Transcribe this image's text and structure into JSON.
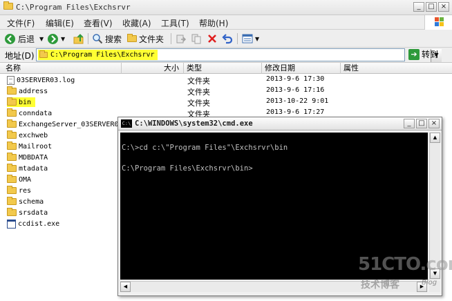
{
  "explorer": {
    "title": "C:\\Program Files\\Exchsrvr",
    "menu": [
      "文件(F)",
      "编辑(E)",
      "查看(V)",
      "收藏(A)",
      "工具(T)",
      "帮助(H)"
    ],
    "toolbar": {
      "back_label": "后退",
      "search_label": "搜索",
      "folders_label": "文件夹"
    },
    "address": {
      "label": "地址(D)",
      "value": "C:\\Program Files\\Exchsrvr",
      "go_label": "转到"
    },
    "columns": {
      "name": "名称",
      "size": "大小",
      "type": "类型",
      "modified": "修改日期",
      "attributes": "属性"
    },
    "files": [
      {
        "name": "03SERVER03.log",
        "icon": "document-icon",
        "type": "文件夹",
        "date": "2013-9-6 17:30"
      },
      {
        "name": "address",
        "icon": "folder-icon",
        "type": "文件夹",
        "date": "2013-9-6 17:16"
      },
      {
        "name": "bin",
        "icon": "folder-icon",
        "type": "文件夹",
        "date": "2013-10-22 9:01",
        "highlighted": true
      },
      {
        "name": "conndata",
        "icon": "folder-icon",
        "type": "文件夹",
        "date": "2013-9-6 17:27"
      },
      {
        "name": "ExchangeServer_03SERVER03",
        "icon": "folder-icon"
      },
      {
        "name": "exchweb",
        "icon": "folder-icon"
      },
      {
        "name": "Mailroot",
        "icon": "folder-icon"
      },
      {
        "name": "MDBDATA",
        "icon": "folder-icon"
      },
      {
        "name": "mtadata",
        "icon": "folder-icon"
      },
      {
        "name": "OMA",
        "icon": "folder-icon"
      },
      {
        "name": "res",
        "icon": "folder-icon"
      },
      {
        "name": "schema",
        "icon": "folder-icon"
      },
      {
        "name": "srsdata",
        "icon": "folder-icon"
      },
      {
        "name": "ccdist.exe",
        "icon": "exe-icon"
      }
    ],
    "highlight_color": "#ffff33"
  },
  "cmd": {
    "title": "C:\\WINDOWS\\system32\\cmd.exe",
    "icon_text": "C:\\",
    "lines": [
      "C:\\>cd c:\\\"Program Files\"\\Exchsrvr\\bin",
      "",
      "C:\\Program Files\\Exchsrvr\\bin>"
    ]
  },
  "watermark": {
    "main": "51CTO.com",
    "sub": "技术博客",
    "blog": "Blog"
  }
}
